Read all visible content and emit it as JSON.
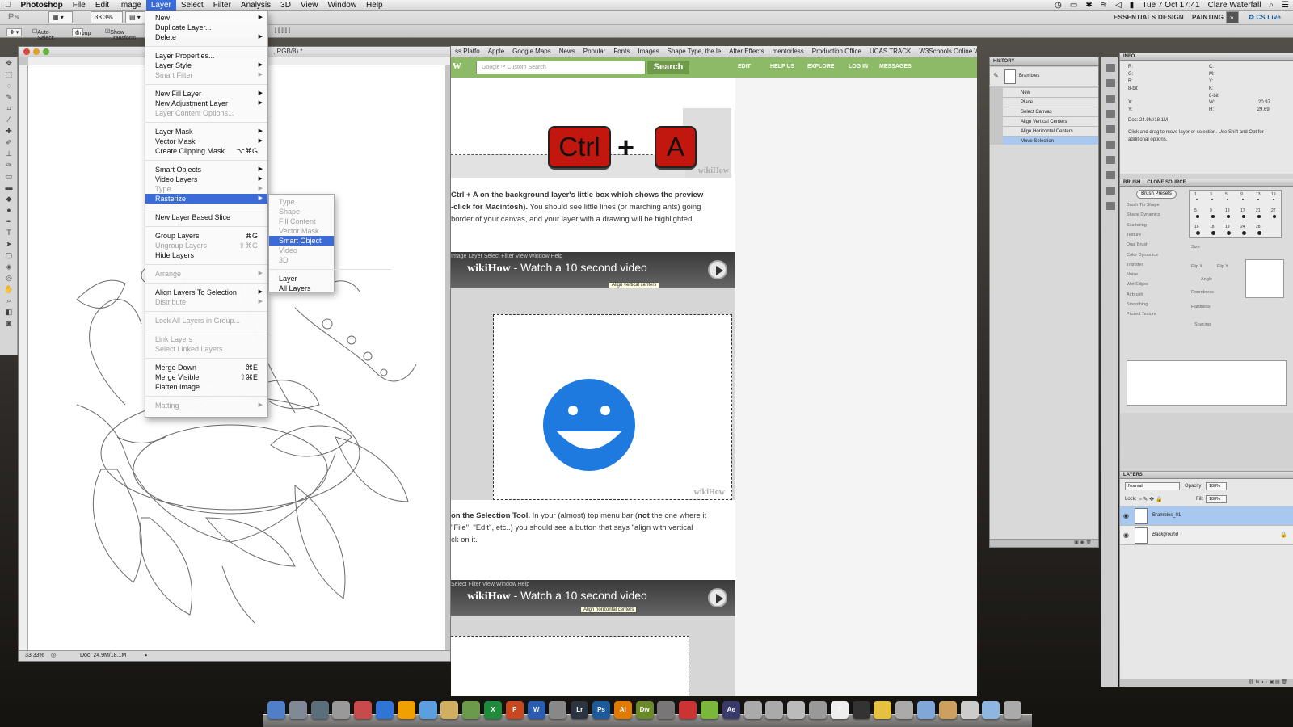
{
  "menubar": {
    "apple": "",
    "app": "Photoshop",
    "items": [
      "File",
      "Edit",
      "Image",
      "Layer",
      "Select",
      "Filter",
      "Analysis",
      "3D",
      "View",
      "Window",
      "Help"
    ],
    "active": "Layer",
    "clock": "Tue 7 Oct  17:41",
    "user": "Clare Waterfall"
  },
  "options_bar": {
    "ps_logo": "Ps",
    "zoom": "33.3%",
    "auto_select_label": "Auto-Select:",
    "auto_select_value": "Group",
    "show_transform": "Show Transform",
    "workspaces": [
      "ESSENTIALS",
      "DESIGN",
      "PAINTING"
    ],
    "cs_live": "CS Live"
  },
  "document": {
    "title": ", RGB/8) *",
    "status_zoom": "33.33%",
    "status_doc": "Doc: 24.9M/18.1M"
  },
  "layer_menu": {
    "items": [
      {
        "label": "New",
        "arrow": "▶"
      },
      {
        "label": "Duplicate Layer..."
      },
      {
        "label": "Delete",
        "arrow": "▶"
      },
      {
        "sep": true
      },
      {
        "label": "Layer Properties..."
      },
      {
        "label": "Layer Style",
        "arrow": "▶"
      },
      {
        "label": "Smart Filter",
        "arrow": "▶",
        "disabled": true
      },
      {
        "sep": true
      },
      {
        "label": "New Fill Layer",
        "arrow": "▶"
      },
      {
        "label": "New Adjustment Layer",
        "arrow": "▶"
      },
      {
        "label": "Layer Content Options...",
        "disabled": true
      },
      {
        "sep": true
      },
      {
        "label": "Layer Mask",
        "arrow": "▶"
      },
      {
        "label": "Vector Mask",
        "arrow": "▶"
      },
      {
        "label": "Create Clipping Mask",
        "shortcut": "⌥⌘G"
      },
      {
        "sep": true
      },
      {
        "label": "Smart Objects",
        "arrow": "▶"
      },
      {
        "label": "Video Layers",
        "arrow": "▶"
      },
      {
        "label": "Type",
        "arrow": "▶",
        "disabled": true
      },
      {
        "label": "Rasterize",
        "arrow": "▶",
        "highlighted": true
      },
      {
        "sep": true
      },
      {
        "label": "New Layer Based Slice"
      },
      {
        "sep": true
      },
      {
        "label": "Group Layers",
        "shortcut": "⌘G"
      },
      {
        "label": "Ungroup Layers",
        "shortcut": "⇧⌘G",
        "disabled": true
      },
      {
        "label": "Hide Layers"
      },
      {
        "sep": true
      },
      {
        "label": "Arrange",
        "arrow": "▶",
        "disabled": true
      },
      {
        "sep": true
      },
      {
        "label": "Align Layers To Selection",
        "arrow": "▶"
      },
      {
        "label": "Distribute",
        "arrow": "▶",
        "disabled": true
      },
      {
        "sep": true
      },
      {
        "label": "Lock All Layers in Group...",
        "disabled": true
      },
      {
        "sep": true
      },
      {
        "label": "Link Layers",
        "disabled": true
      },
      {
        "label": "Select Linked Layers",
        "disabled": true
      },
      {
        "sep": true
      },
      {
        "label": "Merge Down",
        "shortcut": "⌘E"
      },
      {
        "label": "Merge Visible",
        "shortcut": "⇧⌘E"
      },
      {
        "label": "Flatten Image"
      },
      {
        "sep": true
      },
      {
        "label": "Matting",
        "arrow": "▶",
        "disabled": true
      }
    ]
  },
  "rasterize_submenu": {
    "items": [
      {
        "label": "Type",
        "disabled": true
      },
      {
        "label": "Shape",
        "disabled": true
      },
      {
        "label": "Fill Content",
        "disabled": true
      },
      {
        "label": "Vector Mask",
        "disabled": true
      },
      {
        "label": "Smart Object",
        "highlighted": true
      },
      {
        "label": "Video",
        "disabled": true
      },
      {
        "label": "3D",
        "disabled": true
      },
      {
        "sep": true
      },
      {
        "label": "Layer"
      },
      {
        "label": "All Layers"
      }
    ]
  },
  "browser": {
    "bookmarks": [
      "ss Platfo",
      "Apple",
      "Google Maps",
      "News",
      "Popular",
      "Fonts",
      "Images",
      "Shape Type, the le",
      "After Effects",
      "mentorless",
      "Production Office",
      "UCAS TRACK",
      "W3Schools Online W"
    ],
    "logo": "w",
    "search_placeholder": "Google™ Custom Search",
    "search_button": "Search",
    "nav": [
      "EDIT",
      "HELP US",
      "EXPLORE",
      "LOG IN",
      "MESSAGES"
    ],
    "step1": {
      "keys": [
        "Ctrl",
        "A"
      ],
      "plus": "+",
      "watermark": "wikiHow",
      "text_bold": "Ctrl + A on the background layer's little box which shows the preview",
      "text_bold2": "-click for Macintosh).",
      "text_rest": " You should see little lines (or marching ants) going",
      "text_line3": "border of your canvas, and your layer with a drawing will be highlighted."
    },
    "video1": {
      "brand": "wikiHow",
      "title": " - Watch a 10 second video",
      "menu": "Image   Layer   Select   Filter   View   Window   Help",
      "tooltip": "Align vertical centers"
    },
    "step2": {
      "watermark": "wikiHow",
      "text_bold": "on the Selection Tool.",
      "text_rest": " In your (almost) top menu bar (",
      "text_not": "not",
      "text_rest2": " the one where it",
      "text_line2": "\"File\", \"Edit\", etc..) you should see a button that says \"align with vertical",
      "text_line3": "ck on it."
    },
    "video2": {
      "brand": "wikiHow",
      "title": " - Watch a 10 second video",
      "menu": "Select   Filter   View   Window   Help",
      "tooltip": "Align horizontal centers"
    }
  },
  "history_panel": {
    "tab": "HISTORY",
    "snapshot": "Brambles",
    "steps": [
      "New",
      "Place",
      "Select Canvas",
      "Align Vertical Centers",
      "Align Horizontal Centers",
      "Move Selection"
    ],
    "selected": "Move Selection"
  },
  "info_panel": {
    "tab": "INFO",
    "rgb": [
      "R:",
      "G:",
      "B:"
    ],
    "cmyk": [
      "C:",
      "M:",
      "Y:",
      "K:"
    ],
    "bits": "8-bit",
    "xy": [
      "X:",
      "Y:"
    ],
    "wh": [
      "W:",
      "H:"
    ],
    "w_val": "20.97",
    "h_val": "29.69",
    "doc": "Doc: 24.9M/18.1M",
    "hint": "Click and drag to move layer or selection.  Use Shift and Opt for additional options."
  },
  "brush_panel": {
    "tabs": [
      "BRUSH",
      "CLONE SOURCE"
    ],
    "preset_button": "Brush Presets",
    "options": [
      "Brush Tip Shape",
      "Shape Dynamics",
      "Scattering",
      "Texture",
      "Dual Brush",
      "Color Dynamics",
      "Transfer",
      "Noise",
      "Wet Edges",
      "Airbrush",
      "Smoothing",
      "Protect Texture"
    ],
    "sizes": [
      "1",
      "3",
      "5",
      "9",
      "13",
      "19",
      "5",
      "9",
      "13",
      "17",
      "21",
      "27",
      "16",
      "18",
      "19",
      "24",
      "28"
    ],
    "labels": [
      "Size",
      "Flip X",
      "Flip Y",
      "Angle",
      "Roundness",
      "Hardness",
      "Spacing"
    ]
  },
  "layers_panel": {
    "tab": "LAYERS",
    "blend_mode": "Normal",
    "opacity_label": "Opacity:",
    "opacity": "100%",
    "lock_label": "Lock:",
    "fill_label": "Fill:",
    "fill": "100%",
    "layers": [
      {
        "name": "Brambles_01",
        "selected": true
      },
      {
        "name": "Background",
        "selected": false,
        "locked": true
      }
    ]
  },
  "dock": {
    "apps": [
      {
        "label": "",
        "color": "#4f7fc9"
      },
      {
        "label": "",
        "color": "#7f8a96"
      },
      {
        "label": "",
        "color": "#5a6e7c"
      },
      {
        "label": "",
        "color": "#999"
      },
      {
        "label": "",
        "color": "#c94a4a"
      },
      {
        "label": "",
        "color": "#2f75d6"
      },
      {
        "label": "",
        "color": "#f0a000"
      },
      {
        "label": "",
        "color": "#5aa0e0"
      },
      {
        "label": "",
        "color": "#d0b060"
      },
      {
        "label": "",
        "color": "#6a9a4a"
      },
      {
        "label": "X",
        "color": "#1f8a3a"
      },
      {
        "label": "P",
        "color": "#c8471f"
      },
      {
        "label": "W",
        "color": "#2a5cb0"
      },
      {
        "label": "",
        "color": "#888"
      },
      {
        "label": "Lr",
        "color": "#2b3440"
      },
      {
        "label": "Ps",
        "color": "#1d5a9a"
      },
      {
        "label": "Ai",
        "color": "#e07a00"
      },
      {
        "label": "Dw",
        "color": "#6a8a2a"
      },
      {
        "label": "",
        "color": "#777"
      },
      {
        "label": "",
        "color": "#c33"
      },
      {
        "label": "",
        "color": "#7ab83a"
      },
      {
        "label": "Ae",
        "color": "#3a3a6a"
      },
      {
        "label": "",
        "color": "#aaa"
      },
      {
        "label": "",
        "color": "#aaa"
      },
      {
        "label": "",
        "color": "#bbb"
      },
      {
        "label": "",
        "color": "#999"
      },
      {
        "label": "7",
        "color": "#eee"
      },
      {
        "label": "",
        "color": "#333"
      },
      {
        "label": "",
        "color": "#e8c040"
      },
      {
        "label": "",
        "color": "#aaa"
      },
      {
        "label": "",
        "color": "#7fa8d8"
      },
      {
        "label": "",
        "color": "#cda060"
      },
      {
        "label": "",
        "color": "#ccc"
      },
      {
        "label": "",
        "color": "#8db6e0"
      },
      {
        "label": "",
        "color": "#aaa"
      }
    ]
  }
}
